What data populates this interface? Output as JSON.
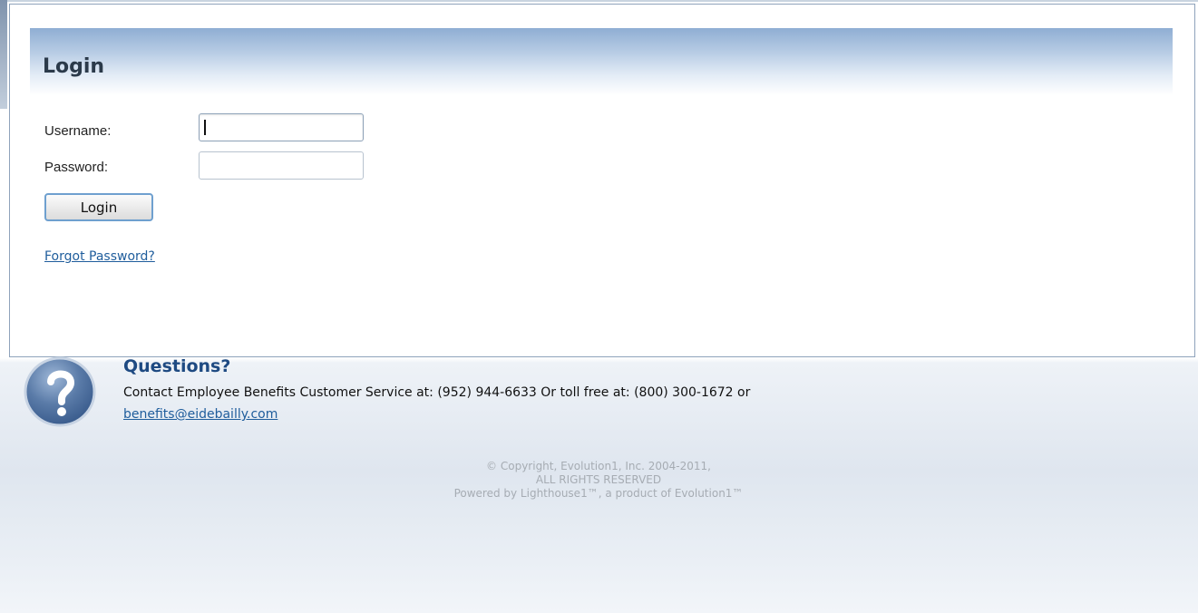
{
  "login": {
    "title": "Login",
    "username_label": "Username:",
    "username_value": "",
    "password_label": "Password:",
    "password_value": "",
    "submit_label": "Login",
    "forgot_password_label": "Forgot Password?"
  },
  "questions": {
    "title": "Questions?",
    "contact_text": "Contact Employee Benefits Customer Service at: (952) 944-6633 Or toll free at: (800) 300-1672 or",
    "email": "benefits@eidebailly.com",
    "icon": "question-mark-icon"
  },
  "footer": {
    "copyright_line1": "© Copyright, Evolution1, Inc. 2004-2011,",
    "copyright_line2": "ALL RIGHTS RESERVED",
    "copyright_line3": "Powered by Lighthouse1™, a product of Evolution1™"
  },
  "colors": {
    "link": "#1f5d9c",
    "header_gradient_top": "#8faed3",
    "questions_title": "#1e4a82",
    "button_border": "#6fa0cf"
  }
}
